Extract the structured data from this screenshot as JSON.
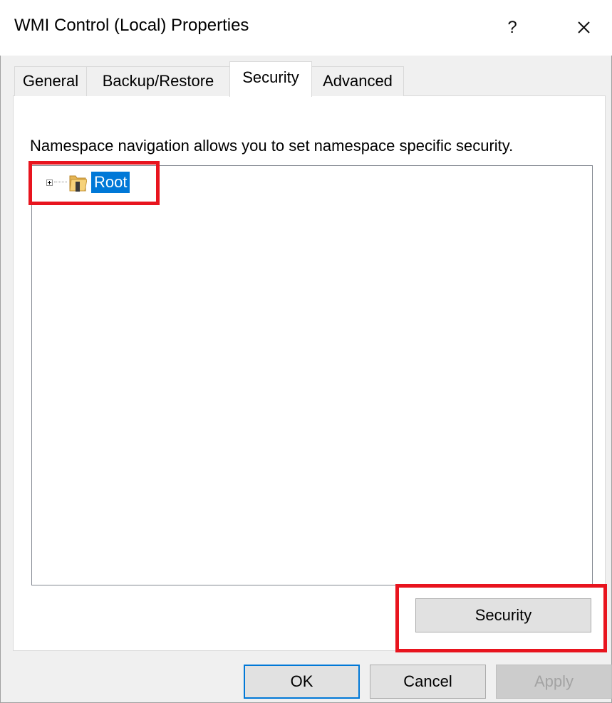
{
  "window": {
    "title": "WMI Control (Local) Properties",
    "help_label": "?"
  },
  "tabs": [
    {
      "label": "General"
    },
    {
      "label": "Backup/Restore"
    },
    {
      "label": "Security",
      "active": true
    },
    {
      "label": "Advanced"
    }
  ],
  "security_page": {
    "description": "Namespace navigation allows you to set namespace specific security.",
    "tree": {
      "root_label": "Root"
    },
    "security_button_label": "Security"
  },
  "footer": {
    "ok_label": "OK",
    "cancel_label": "Cancel",
    "apply_label": "Apply"
  },
  "colors": {
    "selection": "#0078d7",
    "highlight_box": "#e8141e"
  },
  "icons": {
    "close": "close-icon",
    "expander": "plus-box-icon",
    "folder": "folder-icon"
  }
}
